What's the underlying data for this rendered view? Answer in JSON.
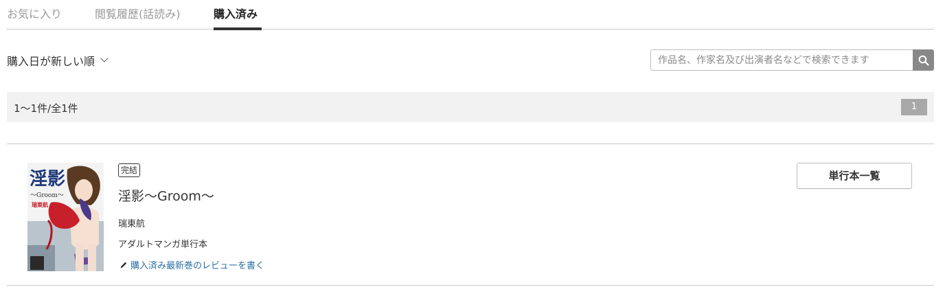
{
  "tabs": [
    {
      "label": "お気に入り"
    },
    {
      "label": "閲覧履歴(話読み)"
    },
    {
      "label": "購入済み"
    }
  ],
  "sort": {
    "label": "購入日が新しい順"
  },
  "search": {
    "placeholder": "作品名、作家名及び出演者名などで検索できます"
  },
  "results": {
    "count_text": "1〜1件/全1件",
    "current_page": "1"
  },
  "item": {
    "badge": "完結",
    "title": "淫影〜Groom〜",
    "author": "瑞東航",
    "genre": "アダルトマンガ単行本",
    "review_link": "購入済み最新巻のレビューを書く",
    "volumes_button": "単行本一覧",
    "cover": {
      "title_text": "淫影",
      "subtitle_text": "〜Groom〜",
      "author_text": "瑞東航"
    }
  },
  "colors": {
    "accent_tab": "#333333",
    "link": "#2b6fa6",
    "search_button": "#888888",
    "page_badge": "#a8a8a8"
  }
}
